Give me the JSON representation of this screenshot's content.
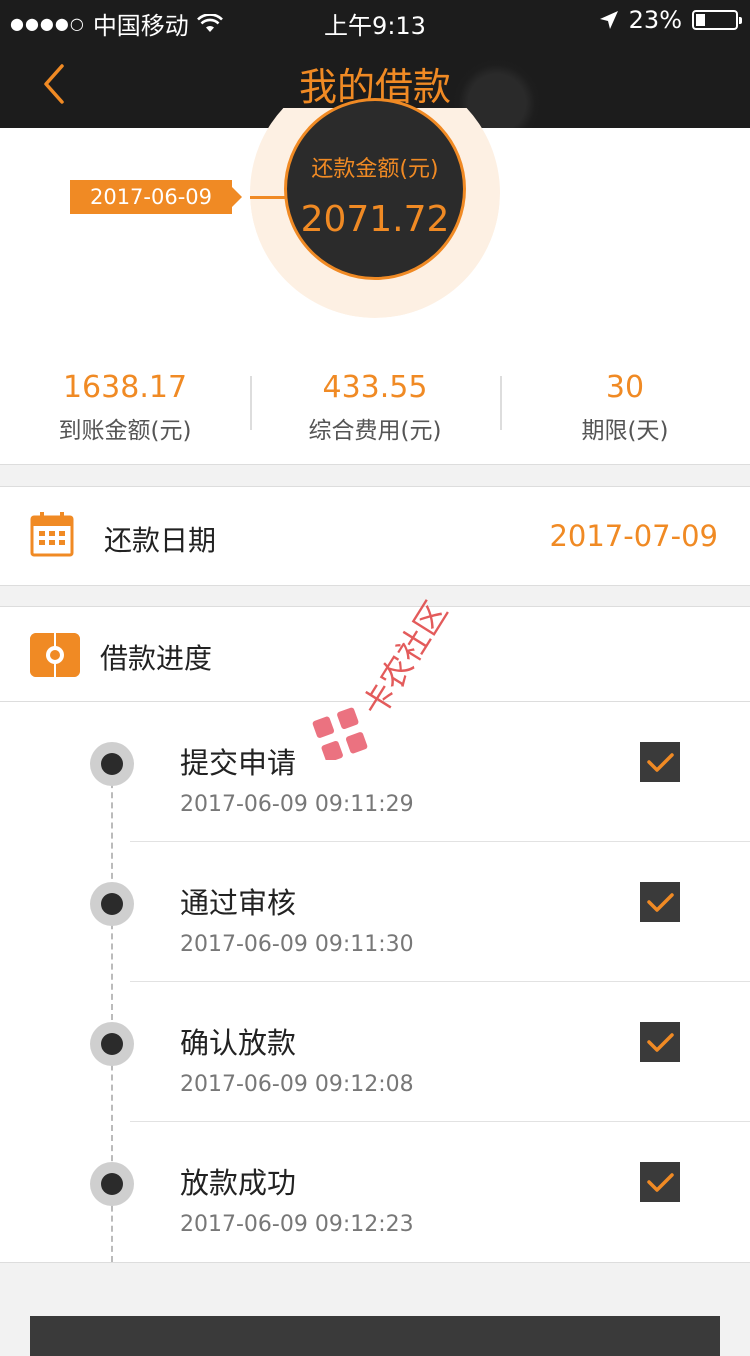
{
  "status_bar": {
    "signal_dots": "●●●●○",
    "carrier": "中国移动",
    "time": "上午9:13",
    "battery_percent": "23%",
    "battery_level": 0.23,
    "icons": [
      "wifi-icon",
      "location-arrow-icon",
      "battery-icon"
    ]
  },
  "nav": {
    "title": "我的借款",
    "back_icon": "chevron-left-icon"
  },
  "summary": {
    "date_tag": "2017-06-09",
    "repay_amount_label": "还款金额(元)",
    "repay_amount": "2071.72",
    "stats": [
      {
        "value": "1638.17",
        "label": "到账金额(元)"
      },
      {
        "value": "433.55",
        "label": "综合费用(元)"
      },
      {
        "value": "30",
        "label": "期限(天)"
      }
    ]
  },
  "repay_date": {
    "label": "还款日期",
    "value": "2017-07-09",
    "icon": "calendar-icon"
  },
  "progress": {
    "label": "借款进度",
    "icon": "progress-icon",
    "steps": [
      {
        "title": "提交申请",
        "time": "2017-06-09 09:11:29",
        "checked": true
      },
      {
        "title": "通过审核",
        "time": "2017-06-09 09:11:30",
        "checked": true
      },
      {
        "title": "确认放款",
        "time": "2017-06-09 09:12:08",
        "checked": true
      },
      {
        "title": "放款成功",
        "time": "2017-06-09 09:12:23",
        "checked": true
      }
    ]
  },
  "watermark": {
    "text": "卡农社区"
  },
  "colors": {
    "accent": "#f08a24",
    "dark": "#1c1c1c",
    "check_bg": "#3a3a3a"
  }
}
